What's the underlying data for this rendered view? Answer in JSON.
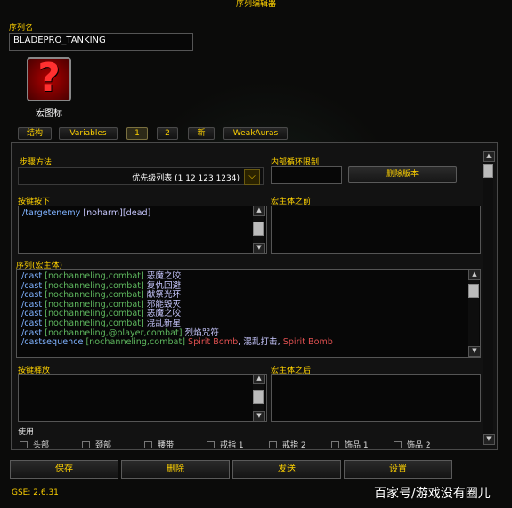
{
  "window": {
    "title": "序列编辑器"
  },
  "sequence_name": {
    "label": "序列名",
    "value": "BLADEPRO_TANKING"
  },
  "macro_icon": {
    "label": "宏图标",
    "glyph": "?"
  },
  "tabs": [
    "结构",
    "Variables",
    "1",
    "2",
    "新",
    "WeakAuras"
  ],
  "step": {
    "label": "步骤方法",
    "value": "优先级列表 (1 12 123 1234)"
  },
  "loop_limit": {
    "label": "内部循环限制",
    "value": ""
  },
  "delete_version": "删除版本",
  "keypress": {
    "label": "按键按下",
    "lines": [
      {
        "cmd": "/targetenemy",
        "arg": " [noharm][dead]"
      }
    ]
  },
  "pre_macro": {
    "label": "宏主体之前"
  },
  "sequence": {
    "label": "序列(宏主体)",
    "lines": [
      {
        "cmd": "/cast",
        "cond": " [nochanneling,combat]",
        "spell": " 恶魔之咬"
      },
      {
        "cmd": "/cast",
        "cond": " [nochanneling,combat]",
        "spell": " 复仇回避"
      },
      {
        "cmd": "/cast",
        "cond": " [nochanneling,combat]",
        "spell": " 献祭光环"
      },
      {
        "cmd": "/cast",
        "cond": " [nochanneling,combat]",
        "spell": " 邪能毁灭"
      },
      {
        "cmd": "/cast",
        "cond": " [nochanneling,combat]",
        "spell": " 恶魔之咬"
      },
      {
        "cmd": "/cast",
        "cond": " [nochanneling,combat]",
        "spell": " 混乱新星"
      },
      {
        "cmd": "/cast",
        "cond": " [nochanneling,@player,combat]",
        "spell": " 烈焰咒符"
      }
    ],
    "last": {
      "cmd": "/castsequence",
      "cond": " [nochanneling,combat]",
      "s1": " Spirit Bomb",
      "s2": ", 混乱打击, ",
      "s3": "Spirit Bomb"
    }
  },
  "keyrelease": {
    "label": "按键释放"
  },
  "post_macro": {
    "label": "宏主体之后"
  },
  "use": {
    "label": "使用",
    "slots": [
      "头部",
      "颈部",
      "腰带",
      "戒指 1",
      "戒指 2",
      "饰品 1",
      "饰品 2"
    ]
  },
  "buttons": {
    "save": "保存",
    "delete": "删除",
    "send": "发送",
    "settings": "设置"
  },
  "version": "GSE: 2.6.31",
  "watermark": "百家号/游戏没有圈儿"
}
